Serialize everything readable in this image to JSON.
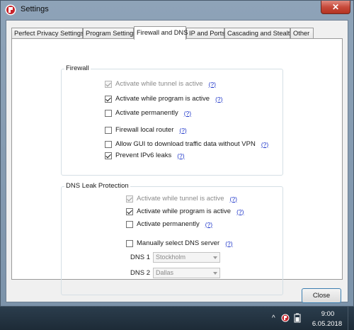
{
  "window": {
    "title": "Settings",
    "close_symbol": "✕"
  },
  "tabs": [
    {
      "label": "Perfect Privacy Settings",
      "active": false
    },
    {
      "label": "Program Settings",
      "active": false
    },
    {
      "label": "Firewall and DNS",
      "active": true
    },
    {
      "label": "IP and Ports",
      "active": false
    },
    {
      "label": "Cascading and Stealth",
      "active": false
    },
    {
      "label": "Other",
      "active": false
    }
  ],
  "firewall": {
    "title": "Firewall",
    "options": [
      {
        "label": "Activate while tunnel is active",
        "checked": true,
        "disabled": true,
        "help": "(?)"
      },
      {
        "label": "Activate while program is active",
        "checked": true,
        "disabled": false,
        "help": "(?)"
      },
      {
        "label": "Activate permanently",
        "checked": false,
        "disabled": false,
        "help": "(?)"
      },
      {
        "label": "Firewall local router",
        "checked": false,
        "disabled": false,
        "help": "(?)"
      },
      {
        "label": "Allow GUI to download traffic data without VPN",
        "checked": false,
        "disabled": false,
        "help": "(?)"
      },
      {
        "label": "Prevent IPv6 leaks",
        "checked": true,
        "disabled": false,
        "help": "(?)"
      }
    ]
  },
  "dns": {
    "title": "DNS Leak Protection",
    "options": [
      {
        "label": "Activate while tunnel is active",
        "checked": true,
        "disabled": true,
        "help": "(?)"
      },
      {
        "label": "Activate while program is active",
        "checked": true,
        "disabled": false,
        "help": "(?)"
      },
      {
        "label": "Activate permanently",
        "checked": false,
        "disabled": false,
        "help": "(?)"
      },
      {
        "label": "Manually select DNS server",
        "checked": false,
        "disabled": false,
        "help": "(?)"
      }
    ],
    "dns1_label": "DNS 1",
    "dns1_value": "Stockholm",
    "dns2_label": "DNS 2",
    "dns2_value": "Dallas"
  },
  "buttons": {
    "close": "Close"
  },
  "taskbar": {
    "time": "9:00",
    "date": "6.05.2018",
    "tray_arrow": "^"
  },
  "colors": {
    "link": "#1d35c9",
    "close_button_red": "#c74a3b"
  }
}
